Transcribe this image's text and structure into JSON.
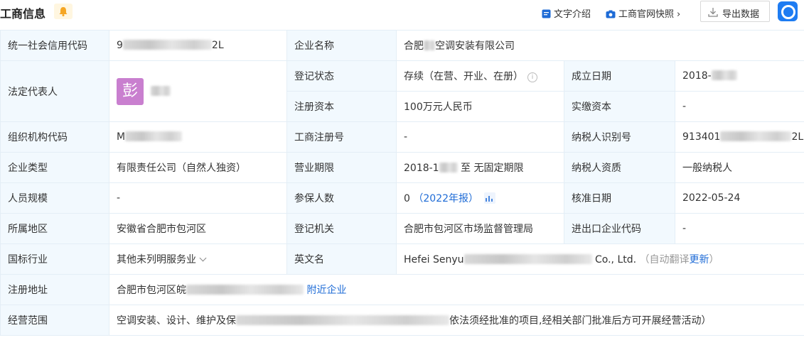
{
  "header": {
    "title": "工商信息",
    "text_intro": "文字介绍",
    "snapshot": "工商官网快照",
    "export": "导出数据"
  },
  "labels": {
    "credit_code": "统一社会信用代码",
    "company_name": "企业名称",
    "legal_rep": "法定代表人",
    "reg_status": "登记状态",
    "founded": "成立日期",
    "reg_capital": "注册资本",
    "paid_capital": "实缴资本",
    "org_code": "组织机构代码",
    "reg_no": "工商注册号",
    "taxpayer_id": "纳税人识别号",
    "company_type": "企业类型",
    "term": "营业期限",
    "taxpayer_qual": "纳税人资质",
    "staff_size": "人员规模",
    "insured": "参保人数",
    "approval_date": "核准日期",
    "region": "所属地区",
    "authority": "登记机关",
    "import_export": "进出口企业代码",
    "industry": "国标行业",
    "english_name": "英文名",
    "address": "注册地址",
    "scope": "经营范围"
  },
  "values": {
    "credit_code_prefix": "9",
    "credit_code_suffix": "2L",
    "company_name_a": "合肥",
    "company_name_b": "空调安装有限公司",
    "legal_rep_avatar": "彭",
    "reg_status": "存续（在营、开业、在册）",
    "founded_prefix": "2018-",
    "reg_capital": "100万元人民币",
    "paid_capital": "-",
    "org_code_prefix": "M",
    "reg_no": "-",
    "taxpayer_id_prefix": "913401",
    "taxpayer_id_suffix": "2L",
    "company_type": "有限责任公司（自然人独资）",
    "term_prefix": "2018-1",
    "term_suffix": "至 无固定期限",
    "taxpayer_qual": "一般纳税人",
    "staff_size": "-",
    "insured_count": "0",
    "insured_report": "（2022年报）",
    "approval_date": "2022-05-24",
    "region": "安徽省合肥市包河区",
    "authority": "合肥市包河区市场监督管理局",
    "import_export": "-",
    "industry": "其他未列明服务业",
    "english_name_prefix": "Hefei Senyu",
    "english_name_suffix": "Co., Ltd.",
    "auto_translate": "（自动翻译",
    "update": "更新",
    "auto_translate_end": "）",
    "address_prefix": "合肥市包河区皖",
    "nearby": "附近企业",
    "scope_a": "空调安装、设计、维护及保",
    "scope_b": "依法须经批准的项目,经相关部门批准后方可开展经营活动）"
  },
  "colors": {
    "label_bg": "#f2f9fe",
    "border": "#e4eef6",
    "link": "#1e6bd6",
    "avatar": "#c97fcf",
    "bell_bg": "#fff6e0"
  }
}
